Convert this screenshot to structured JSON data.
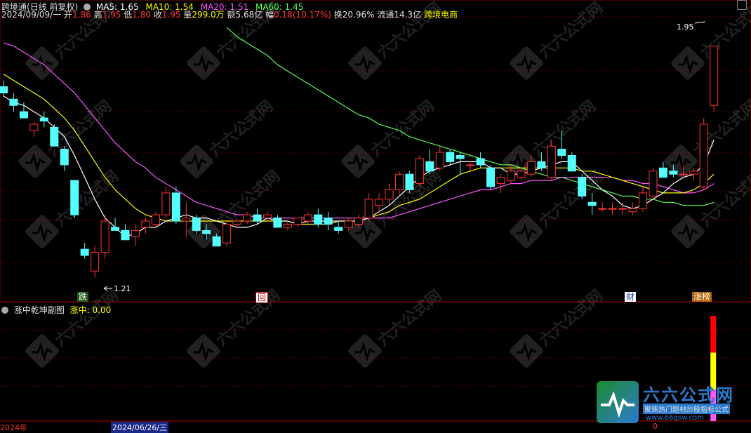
{
  "header": {
    "stock_name": "跨境通",
    "period": "(日线 前复权)",
    "ma5": "MA5: 1.65",
    "ma10": "MA10: 1.54",
    "ma20": "MA20: 1.51",
    "ma60": "MA60: 1.45",
    "date": "2024/09/09/一",
    "open_label": "开",
    "open": "1.86",
    "high_label": "高",
    "high": "1.95",
    "low_label": "低",
    "low": "1.80",
    "close_label": "收",
    "close": "1.95",
    "volume_label": "量",
    "volume": "299.0万",
    "amount_label": "额",
    "amount": "5.68亿",
    "change_label": "幅",
    "change": "0.18(10.17%)",
    "turnover_label": "换",
    "turnover": "20.96%",
    "float_label": "流通",
    "float": "14.3亿",
    "concept": "跨境电商"
  },
  "annotations": {
    "high_price": "1.95",
    "low_price": "1.21",
    "tag_die": "跌",
    "tag_hui": "回",
    "tag_cai": "财",
    "tag_zhangbang": "涨榜"
  },
  "indicator": {
    "title": "涨中乾坤副图",
    "value_label": "涨中: 0.00"
  },
  "bottom_axis": {
    "left_date": "2024年",
    "mid_date": "2024/06/26/三",
    "right_date": "0"
  },
  "watermark": {
    "brand": "六六公式网",
    "slogan": "聚焦热门题材炒股指标公式",
    "url": "www.66gsw.com"
  },
  "colors": {
    "up": "#ff3232",
    "down": "#54ffff",
    "ma5": "#ffffff",
    "ma10": "#ffff00",
    "ma20": "#ff55ff",
    "ma60": "#55ff55"
  },
  "chart_data": {
    "type": "candlestick",
    "price_label_high": "1.95",
    "price_label_low": "1.21",
    "candles": [
      {
        "o": 1.82,
        "h": 1.84,
        "l": 1.79,
        "c": 1.8
      },
      {
        "o": 1.78,
        "h": 1.8,
        "l": 1.74,
        "c": 1.76
      },
      {
        "o": 1.74,
        "h": 1.77,
        "l": 1.72,
        "c": 1.72
      },
      {
        "o": 1.68,
        "h": 1.71,
        "l": 1.66,
        "c": 1.7
      },
      {
        "o": 1.72,
        "h": 1.74,
        "l": 1.69,
        "c": 1.71
      },
      {
        "o": 1.69,
        "h": 1.7,
        "l": 1.63,
        "c": 1.63
      },
      {
        "o": 1.62,
        "h": 1.63,
        "l": 1.55,
        "c": 1.57
      },
      {
        "o": 1.52,
        "h": 1.52,
        "l": 1.4,
        "c": 1.41
      },
      {
        "o": 1.3,
        "h": 1.32,
        "l": 1.27,
        "c": 1.28
      },
      {
        "o": 1.23,
        "h": 1.31,
        "l": 1.21,
        "c": 1.29
      },
      {
        "o": 1.29,
        "h": 1.41,
        "l": 1.27,
        "c": 1.39
      },
      {
        "o": 1.37,
        "h": 1.4,
        "l": 1.36,
        "c": 1.36
      },
      {
        "o": 1.36,
        "h": 1.38,
        "l": 1.33,
        "c": 1.33
      },
      {
        "o": 1.34,
        "h": 1.38,
        "l": 1.31,
        "c": 1.36
      },
      {
        "o": 1.37,
        "h": 1.4,
        "l": 1.35,
        "c": 1.39
      },
      {
        "o": 1.38,
        "h": 1.42,
        "l": 1.37,
        "c": 1.41
      },
      {
        "o": 1.41,
        "h": 1.5,
        "l": 1.4,
        "c": 1.48
      },
      {
        "o": 1.48,
        "h": 1.5,
        "l": 1.38,
        "c": 1.39
      },
      {
        "o": 1.39,
        "h": 1.45,
        "l": 1.34,
        "c": 1.4
      },
      {
        "o": 1.4,
        "h": 1.41,
        "l": 1.35,
        "c": 1.36
      },
      {
        "o": 1.36,
        "h": 1.38,
        "l": 1.33,
        "c": 1.35
      },
      {
        "o": 1.34,
        "h": 1.35,
        "l": 1.31,
        "c": 1.31
      },
      {
        "o": 1.32,
        "h": 1.39,
        "l": 1.31,
        "c": 1.38
      },
      {
        "o": 1.38,
        "h": 1.4,
        "l": 1.37,
        "c": 1.39
      },
      {
        "o": 1.39,
        "h": 1.42,
        "l": 1.38,
        "c": 1.41
      },
      {
        "o": 1.41,
        "h": 1.43,
        "l": 1.38,
        "c": 1.39
      },
      {
        "o": 1.4,
        "h": 1.42,
        "l": 1.39,
        "c": 1.41
      },
      {
        "o": 1.4,
        "h": 1.41,
        "l": 1.37,
        "c": 1.37
      },
      {
        "o": 1.37,
        "h": 1.39,
        "l": 1.36,
        "c": 1.38
      },
      {
        "o": 1.38,
        "h": 1.4,
        "l": 1.37,
        "c": 1.4
      },
      {
        "o": 1.39,
        "h": 1.42,
        "l": 1.38,
        "c": 1.41
      },
      {
        "o": 1.41,
        "h": 1.43,
        "l": 1.37,
        "c": 1.38
      },
      {
        "o": 1.4,
        "h": 1.42,
        "l": 1.36,
        "c": 1.38
      },
      {
        "o": 1.37,
        "h": 1.39,
        "l": 1.35,
        "c": 1.36
      },
      {
        "o": 1.37,
        "h": 1.4,
        "l": 1.36,
        "c": 1.39
      },
      {
        "o": 1.38,
        "h": 1.41,
        "l": 1.37,
        "c": 1.4
      },
      {
        "o": 1.4,
        "h": 1.48,
        "l": 1.39,
        "c": 1.46
      },
      {
        "o": 1.44,
        "h": 1.48,
        "l": 1.42,
        "c": 1.46
      },
      {
        "o": 1.46,
        "h": 1.51,
        "l": 1.44,
        "c": 1.49
      },
      {
        "o": 1.49,
        "h": 1.55,
        "l": 1.47,
        "c": 1.54
      },
      {
        "o": 1.54,
        "h": 1.55,
        "l": 1.48,
        "c": 1.49
      },
      {
        "o": 1.51,
        "h": 1.6,
        "l": 1.5,
        "c": 1.59
      },
      {
        "o": 1.58,
        "h": 1.62,
        "l": 1.54,
        "c": 1.55
      },
      {
        "o": 1.56,
        "h": 1.63,
        "l": 1.55,
        "c": 1.61
      },
      {
        "o": 1.61,
        "h": 1.62,
        "l": 1.57,
        "c": 1.58
      },
      {
        "o": 1.6,
        "h": 1.61,
        "l": 1.54,
        "c": 1.59
      },
      {
        "o": 1.57,
        "h": 1.58,
        "l": 1.55,
        "c": 1.57
      },
      {
        "o": 1.59,
        "h": 1.61,
        "l": 1.56,
        "c": 1.57
      },
      {
        "o": 1.56,
        "h": 1.57,
        "l": 1.49,
        "c": 1.5
      },
      {
        "o": 1.51,
        "h": 1.54,
        "l": 1.48,
        "c": 1.53
      },
      {
        "o": 1.52,
        "h": 1.57,
        "l": 1.51,
        "c": 1.55
      },
      {
        "o": 1.53,
        "h": 1.56,
        "l": 1.52,
        "c": 1.55
      },
      {
        "o": 1.54,
        "h": 1.6,
        "l": 1.53,
        "c": 1.58
      },
      {
        "o": 1.58,
        "h": 1.61,
        "l": 1.55,
        "c": 1.56
      },
      {
        "o": 1.53,
        "h": 1.65,
        "l": 1.52,
        "c": 1.63
      },
      {
        "o": 1.62,
        "h": 1.68,
        "l": 1.59,
        "c": 1.6
      },
      {
        "o": 1.6,
        "h": 1.61,
        "l": 1.55,
        "c": 1.55
      },
      {
        "o": 1.53,
        "h": 1.54,
        "l": 1.46,
        "c": 1.47
      },
      {
        "o": 1.45,
        "h": 1.48,
        "l": 1.41,
        "c": 1.44
      },
      {
        "o": 1.43,
        "h": 1.45,
        "l": 1.42,
        "c": 1.43
      },
      {
        "o": 1.43,
        "h": 1.45,
        "l": 1.41,
        "c": 1.43
      },
      {
        "o": 1.43,
        "h": 1.45,
        "l": 1.41,
        "c": 1.43
      },
      {
        "o": 1.42,
        "h": 1.45,
        "l": 1.41,
        "c": 1.43
      },
      {
        "o": 1.43,
        "h": 1.5,
        "l": 1.42,
        "c": 1.48
      },
      {
        "o": 1.47,
        "h": 1.56,
        "l": 1.46,
        "c": 1.55
      },
      {
        "o": 1.56,
        "h": 1.58,
        "l": 1.53,
        "c": 1.53
      },
      {
        "o": 1.55,
        "h": 1.57,
        "l": 1.53,
        "c": 1.54
      },
      {
        "o": 1.54,
        "h": 1.57,
        "l": 1.53,
        "c": 1.54
      },
      {
        "o": 1.54,
        "h": 1.56,
        "l": 1.52,
        "c": 1.55
      },
      {
        "o": 1.5,
        "h": 1.72,
        "l": 1.49,
        "c": 1.7
      },
      {
        "o": 1.76,
        "h": 1.95,
        "l": 1.74,
        "c": 1.95
      }
    ],
    "ma5": [
      1.79,
      1.77,
      1.76,
      1.74,
      1.72,
      1.69,
      1.66,
      1.6,
      1.53,
      1.46,
      1.4,
      1.37,
      1.34,
      1.35,
      1.37,
      1.37,
      1.39,
      1.4,
      1.41,
      1.4,
      1.4,
      1.39,
      1.38,
      1.37,
      1.37,
      1.38,
      1.4,
      1.39,
      1.39,
      1.38,
      1.39,
      1.39,
      1.39,
      1.39,
      1.39,
      1.39,
      1.4,
      1.42,
      1.44,
      1.47,
      1.5,
      1.53,
      1.55,
      1.56,
      1.57,
      1.58,
      1.58,
      1.58,
      1.56,
      1.56,
      1.54,
      1.54,
      1.55,
      1.56,
      1.57,
      1.58,
      1.58,
      1.55,
      1.52,
      1.49,
      1.47,
      1.44,
      1.43,
      1.44,
      1.46,
      1.48,
      1.51,
      1.53,
      1.54,
      1.57,
      1.65
    ],
    "ma10": [
      1.86,
      1.84,
      1.82,
      1.8,
      1.78,
      1.75,
      1.72,
      1.68,
      1.63,
      1.58,
      1.53,
      1.49,
      1.46,
      1.43,
      1.41,
      1.4,
      1.39,
      1.39,
      1.39,
      1.39,
      1.39,
      1.39,
      1.39,
      1.39,
      1.39,
      1.39,
      1.39,
      1.39,
      1.39,
      1.38,
      1.38,
      1.38,
      1.38,
      1.39,
      1.39,
      1.39,
      1.4,
      1.41,
      1.42,
      1.44,
      1.45,
      1.46,
      1.48,
      1.5,
      1.52,
      1.54,
      1.55,
      1.56,
      1.56,
      1.56,
      1.56,
      1.56,
      1.56,
      1.56,
      1.56,
      1.56,
      1.56,
      1.55,
      1.55,
      1.54,
      1.53,
      1.52,
      1.51,
      1.5,
      1.49,
      1.48,
      1.48,
      1.48,
      1.49,
      1.51,
      1.54
    ],
    "ma20": [
      1.96,
      1.95,
      1.93,
      1.91,
      1.89,
      1.86,
      1.83,
      1.8,
      1.76,
      1.72,
      1.68,
      1.64,
      1.61,
      1.58,
      1.56,
      1.53,
      1.51,
      1.49,
      1.47,
      1.45,
      1.44,
      1.43,
      1.42,
      1.41,
      1.41,
      1.4,
      1.4,
      1.4,
      1.4,
      1.4,
      1.4,
      1.4,
      1.4,
      1.4,
      1.4,
      1.4,
      1.4,
      1.4,
      1.4,
      1.41,
      1.42,
      1.43,
      1.44,
      1.45,
      1.46,
      1.47,
      1.48,
      1.49,
      1.49,
      1.5,
      1.51,
      1.51,
      1.52,
      1.52,
      1.52,
      1.53,
      1.53,
      1.53,
      1.53,
      1.53,
      1.53,
      1.52,
      1.52,
      1.51,
      1.51,
      1.5,
      1.49,
      1.48,
      1.48,
      1.49,
      1.51
    ],
    "ma60": [
      null,
      null,
      null,
      null,
      null,
      null,
      null,
      null,
      null,
      null,
      null,
      null,
      null,
      null,
      null,
      null,
      null,
      null,
      null,
      null,
      null,
      null,
      2.01,
      1.98,
      1.96,
      1.94,
      1.92,
      1.89,
      1.87,
      1.85,
      1.83,
      1.81,
      1.79,
      1.77,
      1.75,
      1.73,
      1.72,
      1.7,
      1.69,
      1.68,
      1.66,
      1.65,
      1.64,
      1.63,
      1.62,
      1.61,
      1.6,
      1.59,
      1.58,
      1.57,
      1.57,
      1.56,
      1.55,
      1.54,
      1.53,
      1.53,
      1.52,
      1.51,
      1.5,
      1.49,
      1.48,
      1.47,
      1.47,
      1.46,
      1.46,
      1.45,
      1.45,
      1.44,
      1.44,
      1.44,
      1.45
    ],
    "indicator_bars": [
      {
        "index": 70,
        "segments": [
          {
            "color": "#ff0000",
            "value": 0.35
          },
          {
            "color": "#ffff00",
            "value": 0.35
          },
          {
            "color": "#ff55ff",
            "value": 0.3
          }
        ]
      }
    ]
  }
}
